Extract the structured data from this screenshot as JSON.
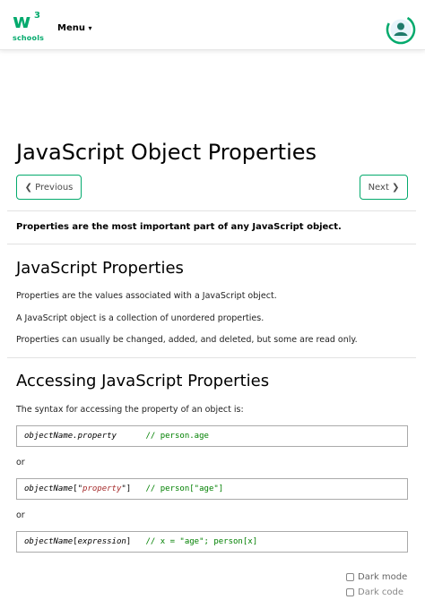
{
  "header": {
    "logo_main": "w",
    "logo_sup": "3",
    "logo_sub": "schools",
    "menu_label": "Menu",
    "menu_caret": "▾"
  },
  "page": {
    "title": "JavaScript Object Properties",
    "prev_label": "❮ Previous",
    "next_label": "Next ❯",
    "intro": "Properties are the most important part of any JavaScript object."
  },
  "section1": {
    "heading": "JavaScript Properties",
    "p1": "Properties are the values associated with a JavaScript object.",
    "p2": "A JavaScript object is a collection of unordered properties.",
    "p3": "Properties can usually be changed, added, and deleted, but some are read only."
  },
  "section2": {
    "heading": "Accessing JavaScript Properties",
    "p1": "The syntax for accessing the property of an object is:",
    "code1": {
      "a": "objectName.property",
      "pad": "      ",
      "comment": "// person.age"
    },
    "or1": "or",
    "code2": {
      "a": "objectName",
      "b": "[\"",
      "c": "property",
      "d": "\"]",
      "pad": "   ",
      "comment": "// person[\"age\"]"
    },
    "or2": "or",
    "code3": {
      "a": "objectName",
      "b": "[",
      "c": "expression",
      "d": "]",
      "pad": "   ",
      "comment": "// x = \"age\"; person[x]"
    }
  },
  "footer_controls": {
    "dark_mode": "Dark mode",
    "dark_code": "Dark code"
  },
  "colors": {
    "accent": "#04AA6D",
    "code_comment": "#008000",
    "code_string": "#a52a2a"
  },
  "icons": {
    "avatar": "user-avatar-icon",
    "menu": "chevron-down-icon"
  }
}
